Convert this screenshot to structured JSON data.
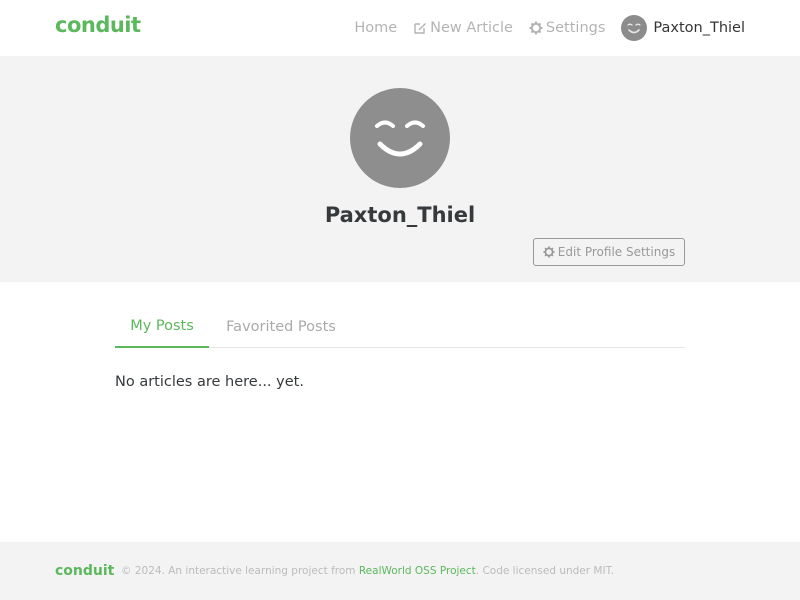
{
  "navbar": {
    "brand": "conduit",
    "items": [
      {
        "label": "Home",
        "icon": ""
      },
      {
        "label": "New Article",
        "icon": "compose-icon"
      },
      {
        "label": "Settings",
        "icon": "gear-icon"
      }
    ],
    "user": {
      "name": "Paxton_Thiel",
      "avatar": "smiley-avatar"
    }
  },
  "profile": {
    "username": "Paxton_Thiel",
    "avatar": "smiley-avatar",
    "edit_button_label": "Edit Profile Settings",
    "edit_button_icon": "gear-icon"
  },
  "tabs": [
    {
      "label": "My Posts",
      "active": true
    },
    {
      "label": "Favorited Posts",
      "active": false
    }
  ],
  "feed": {
    "empty_message": "No articles are here... yet."
  },
  "footer": {
    "brand": "conduit",
    "text_before": "© 2024. An interactive learning project from ",
    "link_text": "RealWorld OSS Project",
    "text_after": ". Code licensed under MIT."
  },
  "colors": {
    "brand_green": "#5cb85c",
    "banner_bg": "#f3f3f3",
    "muted_text": "#999999",
    "avatar_gray": "#8e8e8e"
  }
}
